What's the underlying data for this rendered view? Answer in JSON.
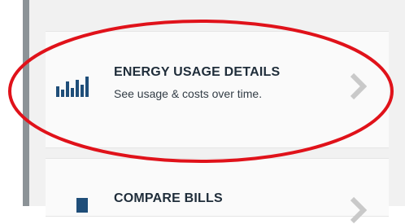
{
  "cards": [
    {
      "title": "ENERGY USAGE DETAILS",
      "subtitle": "See usage & costs over time.",
      "icon": "bar-chart-icon",
      "chevron": "chevron-right-icon"
    },
    {
      "title": "COMPARE BILLS",
      "icon": "bill-icon",
      "chevron": "chevron-right-icon"
    }
  ],
  "colors": {
    "accent": "#1f4e79",
    "annotation_red": "#e0121a",
    "chevron": "#c9c9c9",
    "left_rail": "#8c9397"
  }
}
